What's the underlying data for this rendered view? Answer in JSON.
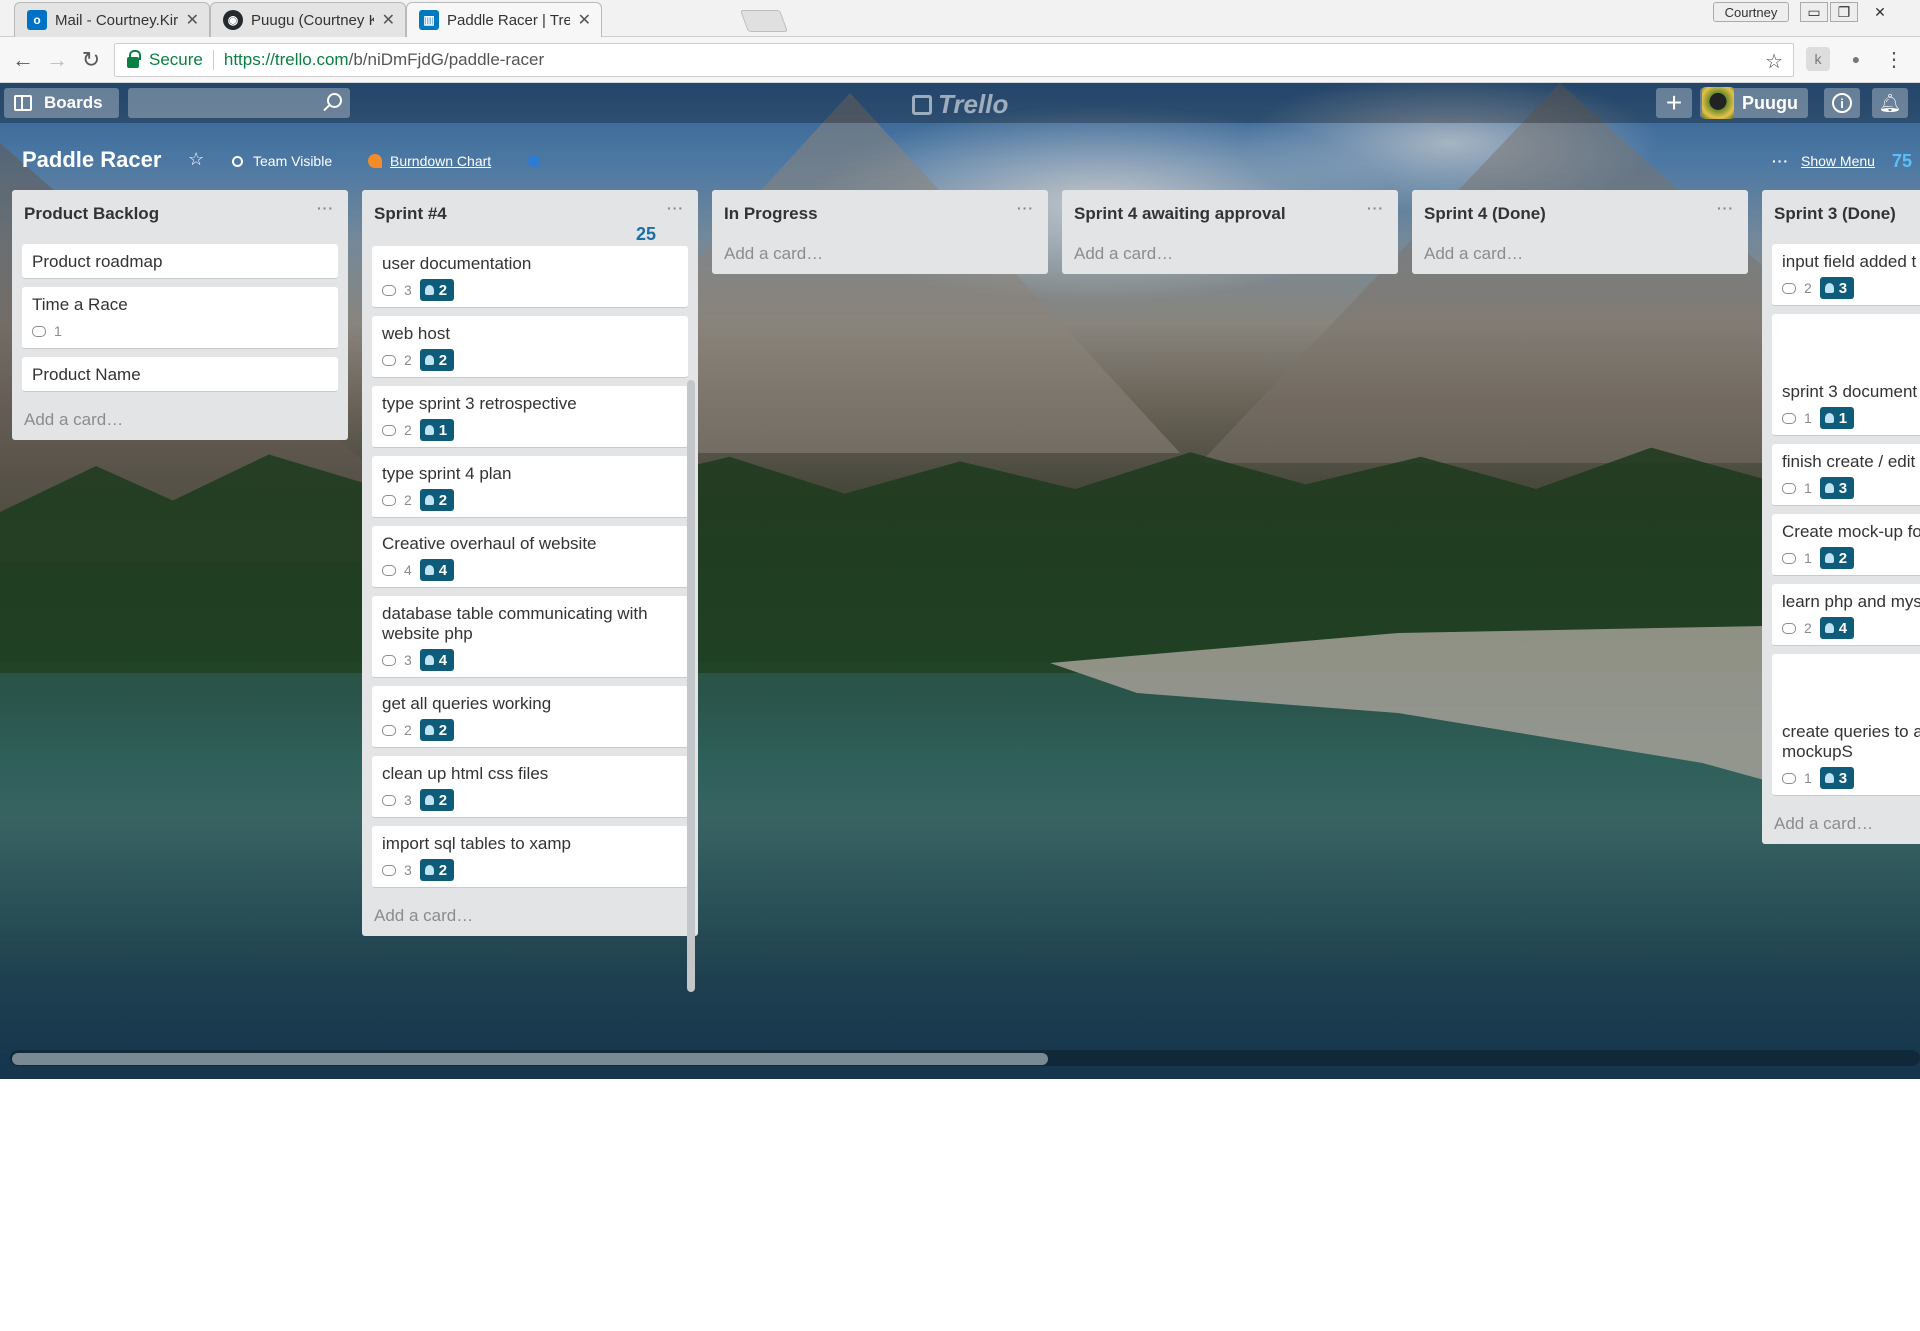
{
  "browser": {
    "tabs": [
      {
        "title": "Mail - Courtney.Kirkham",
        "favicon": "outlook-icon",
        "color": "#0072c6",
        "active": false
      },
      {
        "title": "Puugu (Courtney Kirkham",
        "favicon": "github-icon",
        "color": "#24292e",
        "active": false
      },
      {
        "title": "Paddle Racer | Trello",
        "favicon": "trello-icon",
        "color": "#0079bf",
        "active": true
      }
    ],
    "profile_name": "Courtney",
    "secure_label": "Secure",
    "url_host": "https://trello.com",
    "url_path": "/b/niDmFjdG/paddle-racer"
  },
  "trello": {
    "header": {
      "boards_label": "Boards",
      "logo_text": "Trello",
      "member_name": "Puugu"
    },
    "board": {
      "title": "Paddle Racer",
      "visibility_label": "Team Visible",
      "powerup_label": "Burndown Chart",
      "show_menu_label": "Show Menu",
      "total_points": "75"
    },
    "lists": [
      {
        "name": "Product Backlog",
        "points": "",
        "cards": [
          {
            "title": "Product roadmap",
            "comments": "",
            "points": ""
          },
          {
            "title": "Time a Race",
            "comments": "1",
            "points": ""
          },
          {
            "title": "Product Name",
            "comments": "",
            "points": ""
          }
        ],
        "add_card": "Add a card…"
      },
      {
        "name": "Sprint #4",
        "points": "25",
        "cards": [
          {
            "title": "user documentation",
            "comments": "3",
            "points": "2"
          },
          {
            "title": "web host",
            "comments": "2",
            "points": "2"
          },
          {
            "title": "type sprint 3 retrospective",
            "comments": "2",
            "points": "1"
          },
          {
            "title": "type sprint 4 plan",
            "comments": "2",
            "points": "2"
          },
          {
            "title": "Creative overhaul of website",
            "comments": "4",
            "points": "4"
          },
          {
            "title": "database table communicating with website php",
            "comments": "3",
            "points": "4"
          },
          {
            "title": "get all queries working",
            "comments": "2",
            "points": "2"
          },
          {
            "title": "clean up html css files",
            "comments": "3",
            "points": "2"
          },
          {
            "title": "import sql tables to xamp",
            "comments": "3",
            "points": "2"
          }
        ],
        "add_card": "Add a card…"
      },
      {
        "name": "In Progress",
        "points": "",
        "cards": [],
        "add_card": "Add a card…"
      },
      {
        "name": "Sprint 4 awaiting approval",
        "points": "",
        "cards": [],
        "add_card": "Add a card…"
      },
      {
        "name": "Sprint 4 (Done)",
        "points": "",
        "cards": [],
        "add_card": "Add a card…"
      },
      {
        "name": "Sprint 3 (Done)",
        "points": "",
        "cards": [
          {
            "title": "input field added t",
            "comments": "2",
            "points": "3"
          },
          {
            "title": "sprint 3 document",
            "comments": "1",
            "points": "1"
          },
          {
            "title": "finish create / edit",
            "comments": "1",
            "points": "3"
          },
          {
            "title": "Create mock-up fo",
            "comments": "1",
            "points": "2"
          },
          {
            "title": "learn php and mys",
            "comments": "2",
            "points": "4"
          },
          {
            "title": "create queries to a database, based o mockupS",
            "comments": "1",
            "points": "3"
          }
        ],
        "add_card": "Add a card…"
      }
    ]
  }
}
